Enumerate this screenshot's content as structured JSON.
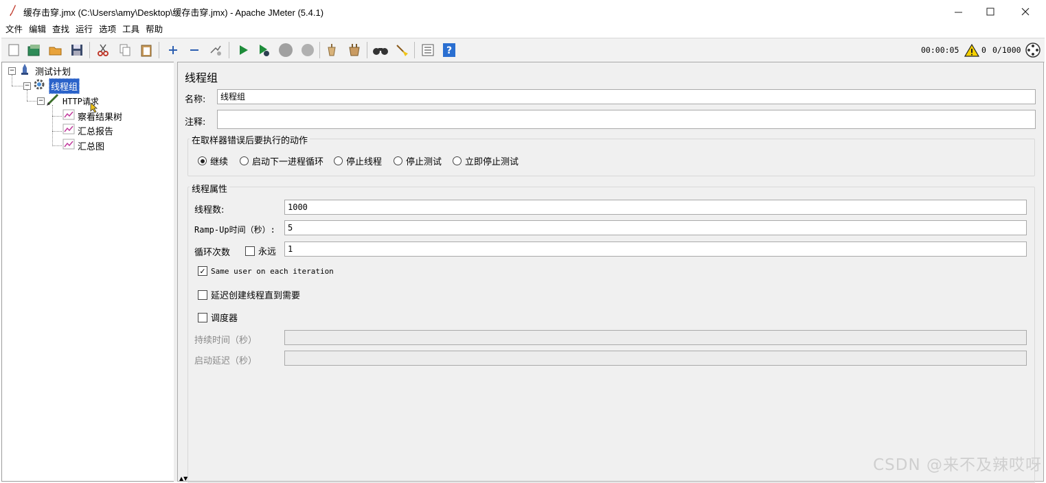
{
  "window": {
    "title": "缓存击穿.jmx (C:\\Users\\amy\\Desktop\\缓存击穿.jmx) - Apache JMeter (5.4.1)",
    "minimize": "—",
    "maximize": "☐",
    "close": "✕"
  },
  "menu": [
    "文件",
    "编辑",
    "查找",
    "运行",
    "选项",
    "工具",
    "帮助"
  ],
  "toolbar": {
    "icons": [
      "new-icon",
      "templates-icon",
      "open-icon",
      "save-icon",
      "cut-icon",
      "copy-icon",
      "paste-icon",
      "expand-icon",
      "collapse-icon",
      "toggle-icon",
      "start-icon",
      "start-no-pause-icon",
      "stop-icon",
      "shutdown-icon",
      "clear-icon",
      "clear-all-icon",
      "search-icon",
      "reset-search-icon",
      "function-helper-icon",
      "help-icon"
    ],
    "timer": "00:00:05",
    "errors": "0",
    "threads": "0/1000"
  },
  "tree": {
    "test_plan": "测试计划",
    "thread_group": "线程组",
    "http_request": "HTTP请求",
    "listeners": [
      "察看结果树",
      "汇总报告",
      "汇总图"
    ]
  },
  "panel": {
    "title": "线程组",
    "name_label": "名称:",
    "name_value": "线程组",
    "comment_label": "注释:",
    "comment_value": "",
    "on_error": {
      "title": "在取样器错误后要执行的动作",
      "options": [
        "继续",
        "启动下一进程循环",
        "停止线程",
        "停止测试",
        "立即停止测试"
      ],
      "selected": "继续"
    },
    "thread_props": {
      "title": "线程属性",
      "threads_label": "线程数:",
      "threads_value": "1000",
      "rampup_label": "Ramp-Up时间（秒）:",
      "rampup_value": "5",
      "loop_label": "循环次数",
      "forever_label": "永远",
      "loop_value": "1",
      "same_user_label": "Same user on each iteration",
      "same_user_checked": true,
      "delay_label": "延迟创建线程直到需要",
      "scheduler_label": "调度器",
      "duration_label": "持续时间（秒）",
      "startup_delay_label": "启动延迟（秒）"
    }
  },
  "watermark": "CSDN @来不及辣哎呀"
}
